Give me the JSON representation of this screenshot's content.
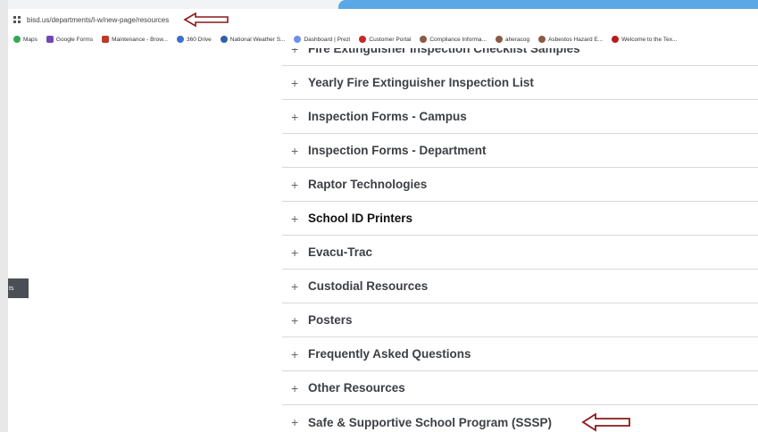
{
  "browser": {
    "url": "bisd.us/departments/l-w/new-page/resources",
    "bookmarks": [
      {
        "label": "Maps",
        "color": "#34a853",
        "icon": "map-pin-icon"
      },
      {
        "label": "Google Forms",
        "color": "#7248b9",
        "icon": "forms-icon"
      },
      {
        "label": "Maintenance - Brow...",
        "color": "#c0392b",
        "icon": "maintenance-icon"
      },
      {
        "label": "360 Drive",
        "color": "#3b6fd1",
        "icon": "drive-icon"
      },
      {
        "label": "National Weather S...",
        "color": "#2e5fa8",
        "icon": "weather-icon"
      },
      {
        "label": "Dashboard | Prezi",
        "color": "#6e8ef0",
        "icon": "prezi-icon"
      },
      {
        "label": "Customer Portal",
        "color": "#c62828",
        "icon": "portal-icon"
      },
      {
        "label": "Compliance Informa...",
        "color": "#8a5a44",
        "icon": "compliance-icon"
      },
      {
        "label": "aheracog",
        "color": "#8a5a44",
        "icon": "aheracog-icon"
      },
      {
        "label": "Asbestos Hazard E...",
        "color": "#8a5a44",
        "icon": "asbestos-icon"
      },
      {
        "label": "Welcome to the Tex...",
        "color": "#b71c1c",
        "icon": "texas-icon"
      }
    ]
  },
  "sidebar_tab": {
    "label": "ts"
  },
  "accordion": {
    "items": [
      {
        "label": "Fire Extinguisher Inspection Checklist Samples"
      },
      {
        "label": "Yearly Fire Extinguisher Inspection List"
      },
      {
        "label": "Inspection Forms - Campus"
      },
      {
        "label": "Inspection Forms - Department"
      },
      {
        "label": "Raptor Technologies"
      },
      {
        "label": "School ID Printers"
      },
      {
        "label": "Evacu-Trac"
      },
      {
        "label": "Custodial Resources"
      },
      {
        "label": "Posters"
      },
      {
        "label": "Frequently Asked Questions"
      },
      {
        "label": "Other Resources"
      },
      {
        "label": "Safe & Supportive School Program (SSSP)"
      }
    ],
    "expand_symbol": "+"
  },
  "colors": {
    "annotation_arrow": "#8b1a1a",
    "accent_bar": "#5aa9e6"
  }
}
